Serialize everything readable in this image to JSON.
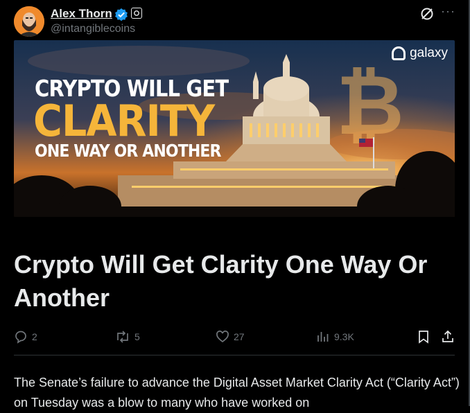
{
  "author": {
    "name": "Alex Thorn",
    "handle": "@intangiblecoins",
    "verified": true
  },
  "banner": {
    "line1": "CRYPTO WILL GET",
    "line2": "CLARITY",
    "line3": "ONE WAY OR ANOTHER",
    "brand": "galaxy"
  },
  "article": {
    "title": "Crypto Will Get Clarity One Way Or Another",
    "body": "The Senate’s failure to advance the Digital Asset Market Clarity Act (“Clarity Act”) on Tuesday was a blow to many who have worked on"
  },
  "actions": {
    "replies": "2",
    "reposts": "5",
    "likes": "27",
    "views": "9.3K"
  },
  "colors": {
    "background": "#000000",
    "text": "#e7e9ea",
    "muted": "#71767b",
    "verified": "#1d9bf0",
    "accent_gold": "#f5b53a"
  }
}
